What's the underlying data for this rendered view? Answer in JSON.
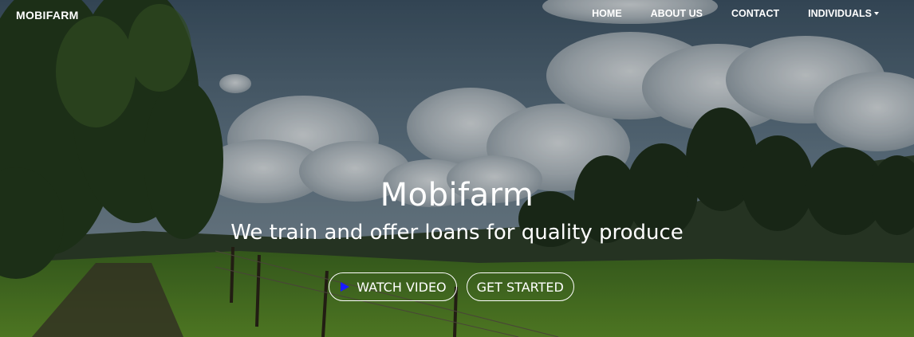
{
  "nav": {
    "brand": "MOBIFARM",
    "links": [
      {
        "label": "HOME"
      },
      {
        "label": "ABOUT US"
      },
      {
        "label": "CONTACT"
      },
      {
        "label": "INDIVIDUALS"
      }
    ]
  },
  "hero": {
    "title": "Mobifarm",
    "subtitle": "We train and offer loans for quality produce",
    "watch_label": "WATCH VIDEO",
    "start_label": "GET STARTED"
  },
  "icons": {
    "play": "play-icon",
    "dropdown": "caret-down-icon"
  },
  "colors": {
    "play_icon": "#1a1aff",
    "text": "#ffffff"
  }
}
